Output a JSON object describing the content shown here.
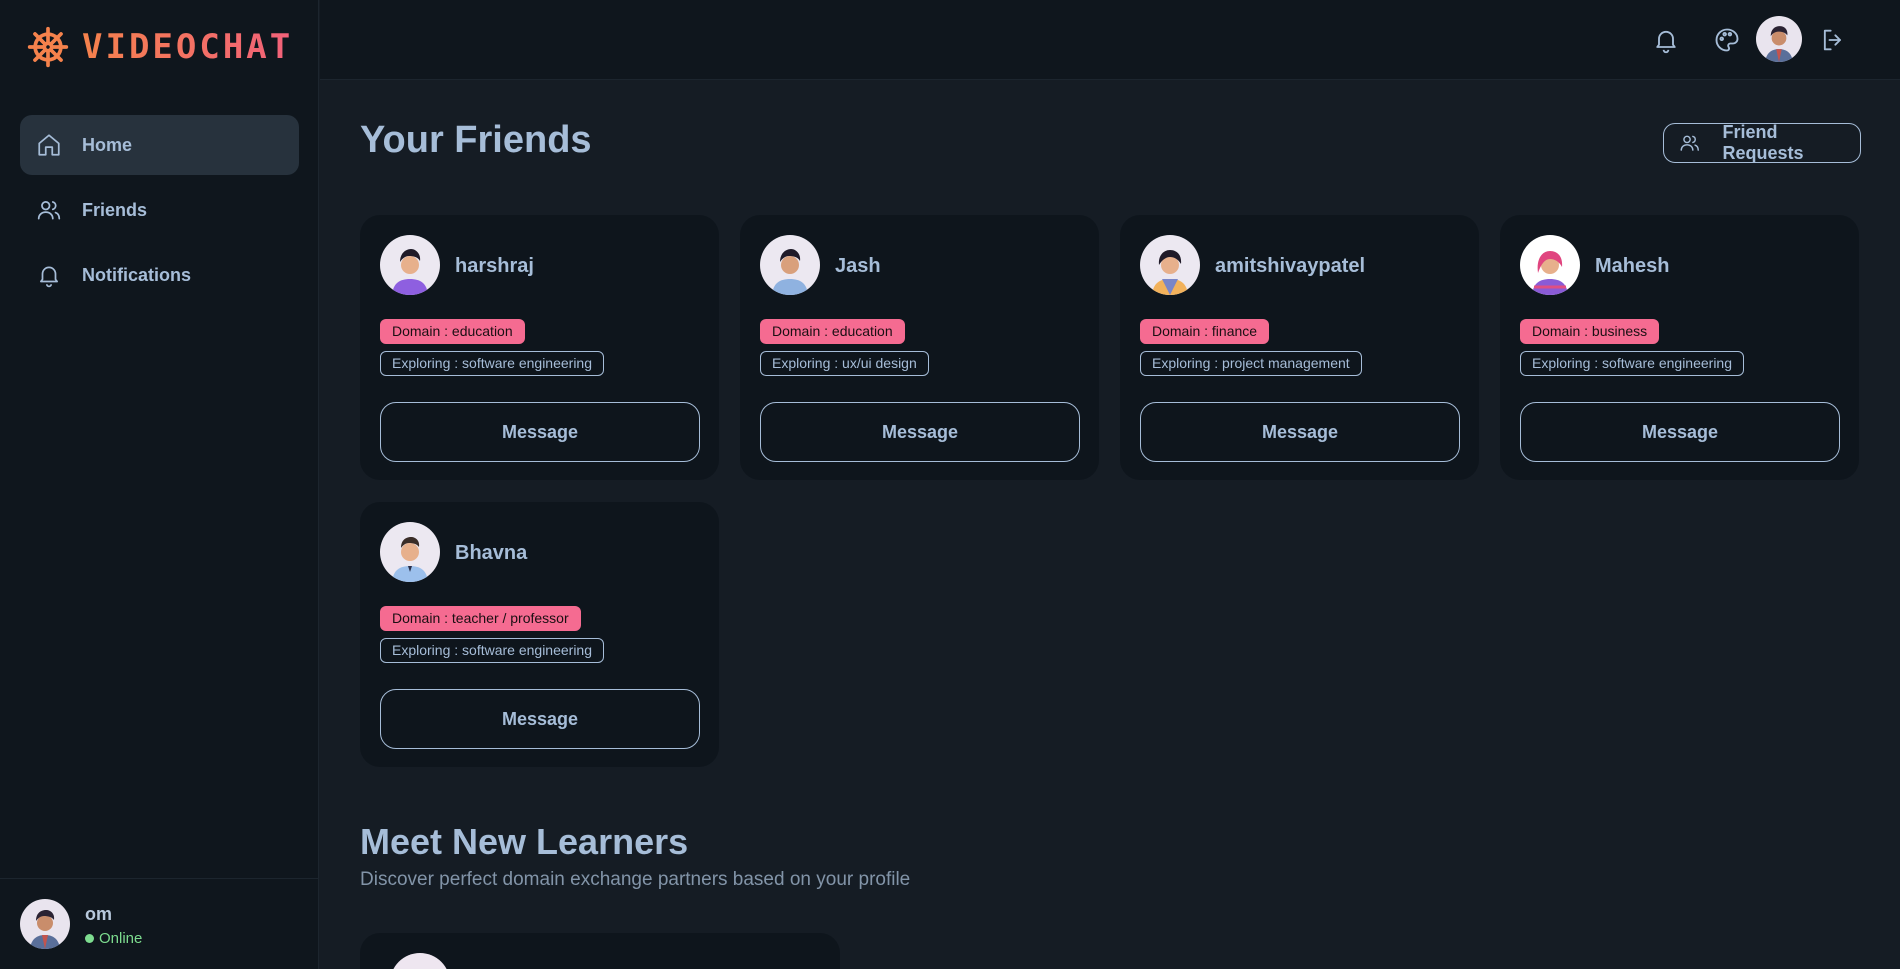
{
  "app": {
    "title": "VIDEOCHAT"
  },
  "sidebar": {
    "items": [
      {
        "label": "Home",
        "icon": "home-icon",
        "active": true
      },
      {
        "label": "Friends",
        "icon": "users-icon",
        "active": false
      },
      {
        "label": "Notifications",
        "icon": "bell-icon",
        "active": false
      }
    ],
    "user": {
      "name": "om",
      "status": "Online"
    }
  },
  "header": {
    "icons": [
      "bell-icon",
      "palette-icon",
      "avatar",
      "logout-icon"
    ]
  },
  "main": {
    "title": "Your Friends",
    "friend_requests_label": "Friend Requests",
    "friends": [
      {
        "name": "harshraj",
        "domain": "Domain : education",
        "exploring": "Exploring : software engineering",
        "button": "Message"
      },
      {
        "name": "Jash",
        "domain": "Domain : education",
        "exploring": "Exploring : ux/ui design",
        "button": "Message"
      },
      {
        "name": "amitshivaypatel",
        "domain": "Domain : finance",
        "exploring": "Exploring : project management",
        "button": "Message"
      },
      {
        "name": "Mahesh",
        "domain": "Domain : business",
        "exploring": "Exploring : software engineering",
        "button": "Message"
      },
      {
        "name": "Bhavna",
        "domain": "Domain : teacher / professor",
        "exploring": "Exploring : software engineering",
        "button": "Message"
      }
    ],
    "learners_title": "Meet New Learners",
    "learners_subtitle": "Discover perfect domain exchange partners based on your profile"
  },
  "colors": {
    "accent_pink": "#f56b91",
    "accent_orange": "#f5824c",
    "text": "#a6bdd8",
    "online": "#7ddc8f"
  }
}
